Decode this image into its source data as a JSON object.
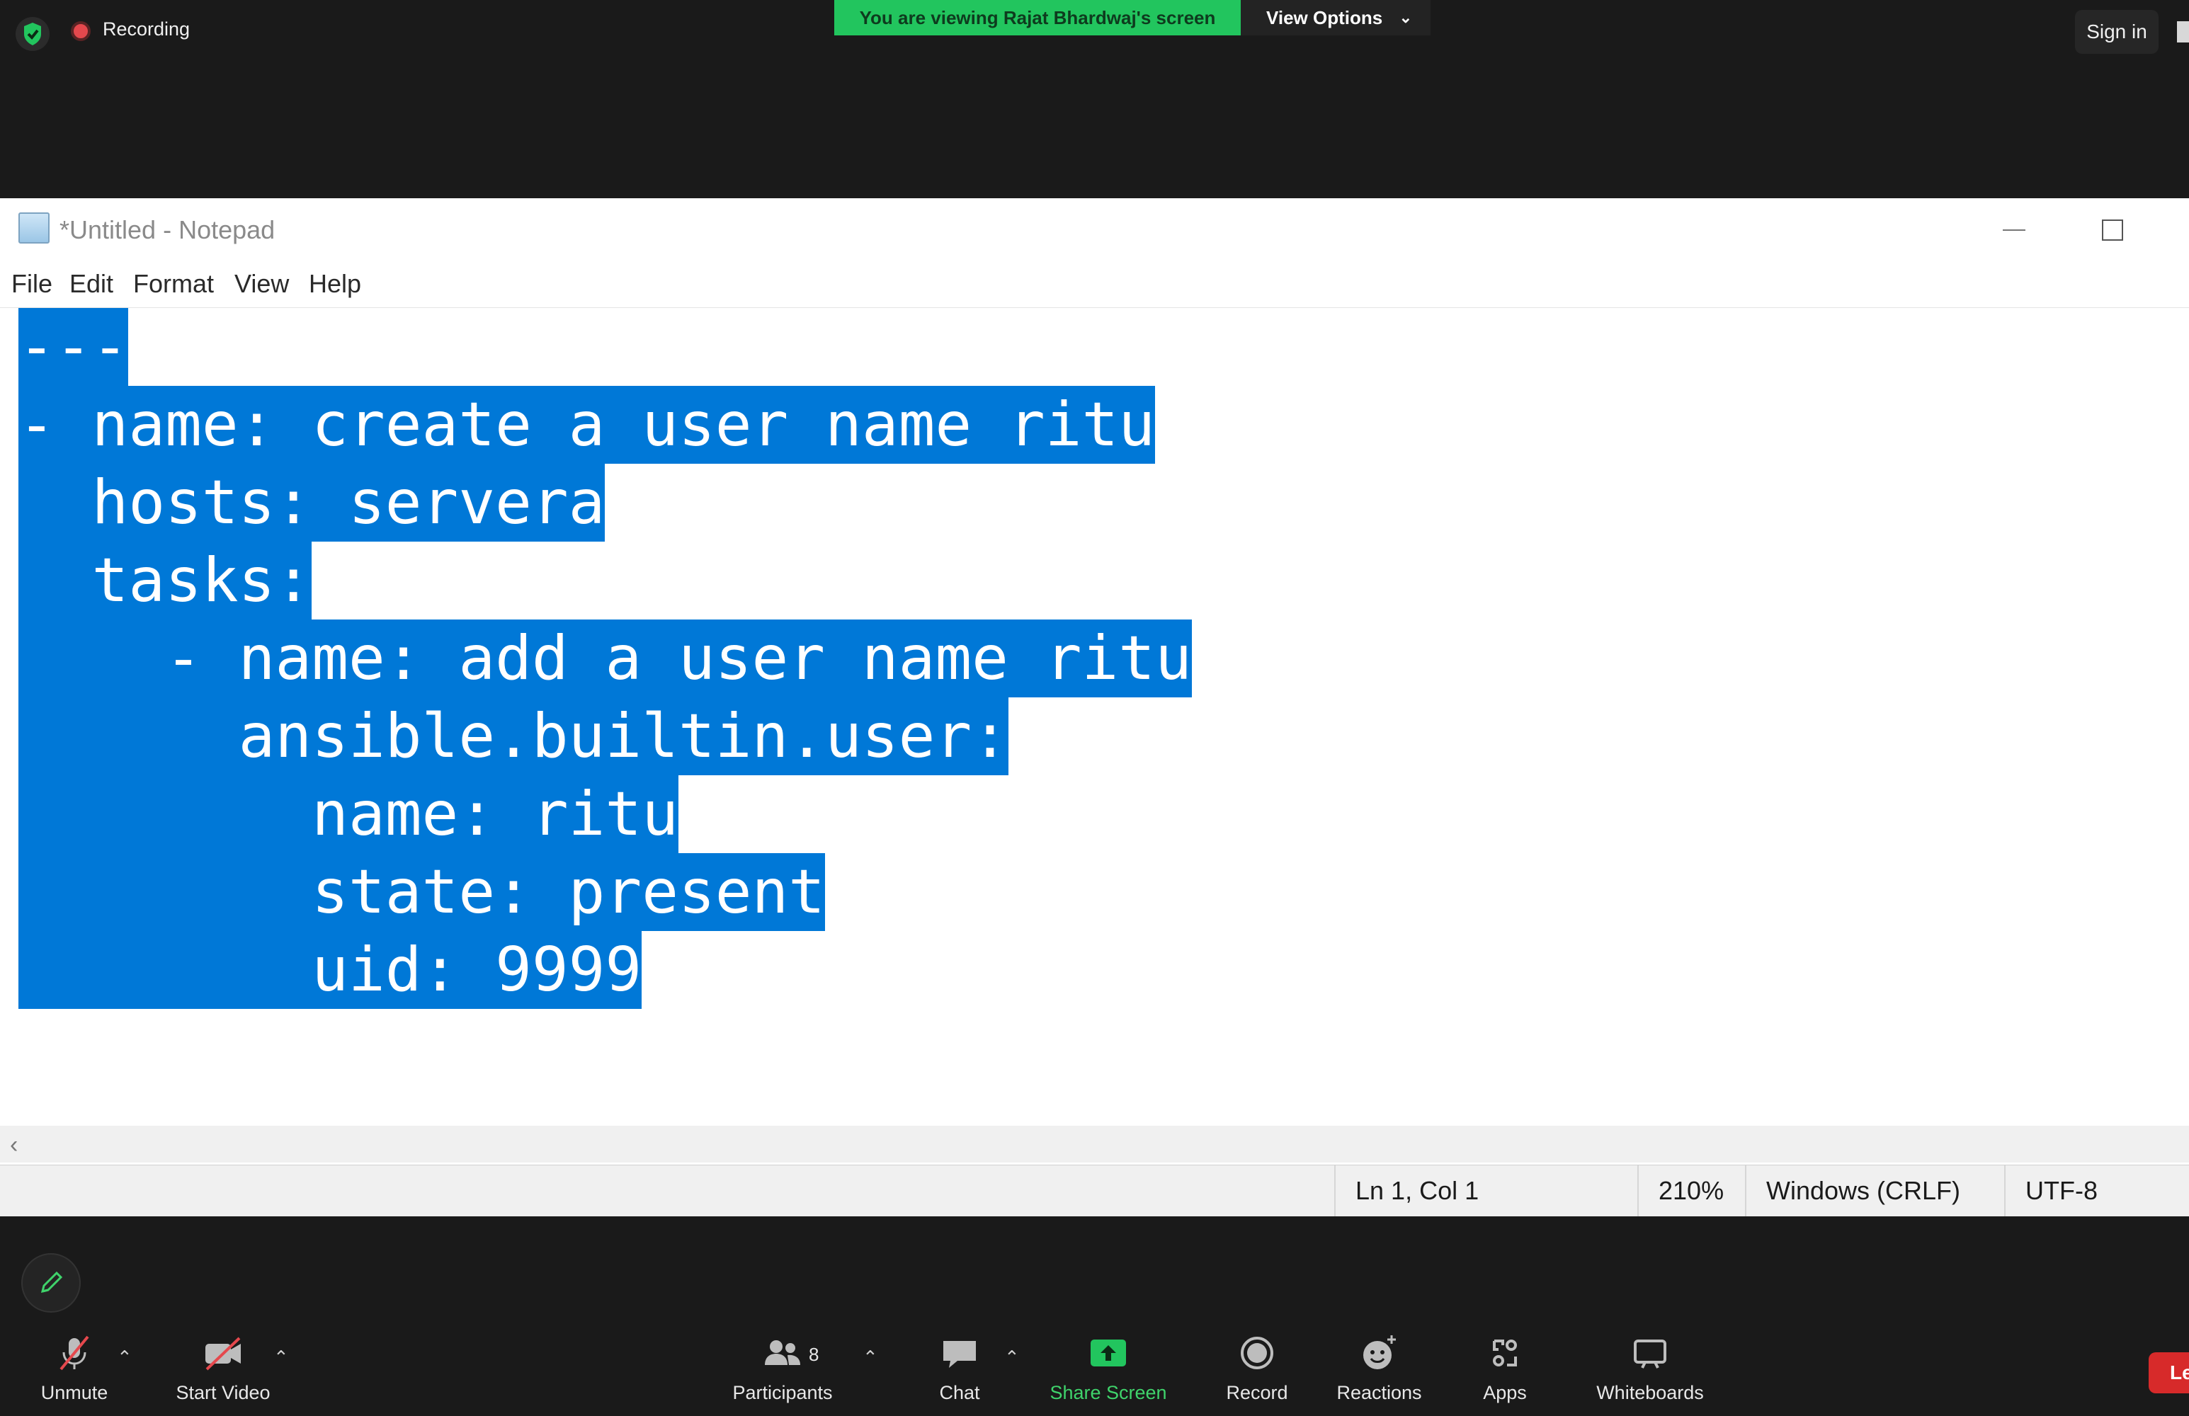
{
  "zoom": {
    "recording_label": "Recording",
    "viewing_banner": "You are viewing Rajat Bhardwaj's screen",
    "view_options_label": "View Options",
    "sign_in_label": "Sign in",
    "leave_label": "Le",
    "toolbar": {
      "unmute": "Unmute",
      "start_video": "Start Video",
      "participants": "Participants",
      "participants_count": "8",
      "chat": "Chat",
      "share_screen": "Share Screen",
      "record": "Record",
      "reactions": "Reactions",
      "apps": "Apps",
      "whiteboards": "Whiteboards"
    },
    "colors": {
      "share_green": "#22c55e",
      "leave_red": "#d72a2a",
      "record_red": "#e5484d"
    }
  },
  "notepad": {
    "title": "*Untitled - Notepad",
    "menu": [
      "File",
      "Edit",
      "Format",
      "View",
      "Help"
    ],
    "lines": [
      "---",
      "- name: create a user name ritu",
      "  hosts: servera",
      "  tasks:",
      "    - name: add a user name ritu",
      "      ansible.builtin.user:",
      "        name: ritu",
      "        state: present",
      "        uid: 9999"
    ],
    "selection_color": "#0078d7",
    "status": {
      "position": "Ln 1, Col 1",
      "zoom": "210%",
      "line_ending": "Windows (CRLF)",
      "encoding": "UTF-8"
    }
  }
}
